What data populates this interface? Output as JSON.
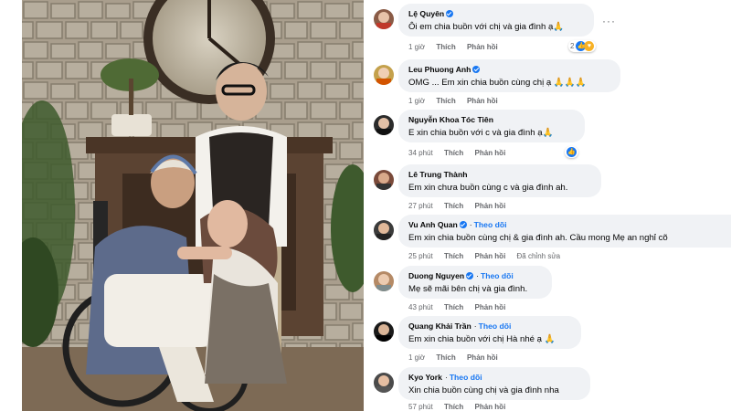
{
  "comments": [
    {
      "name": "Lệ Quyên",
      "verified": true,
      "follow": "",
      "text": "Ôi em chia buồn với chị và gia đình ạ🙏",
      "time": "1 giờ",
      "like": "Thích",
      "reply": "Phản hồi",
      "edited": "",
      "react_count": "2"
    },
    {
      "name": "Leu Phuong Anh",
      "verified": true,
      "follow": "",
      "text": "OMG ... Em xin chia buồn cùng chị ạ 🙏🙏🙏",
      "time": "1 giờ",
      "like": "Thích",
      "reply": "Phản hồi",
      "edited": "",
      "react_count": ""
    },
    {
      "name": "Nguyễn Khoa Tóc Tiên",
      "verified": false,
      "follow": "",
      "text": "E xin chia buồn với c và gia đình ạ🙏",
      "time": "34 phút",
      "like": "Thích",
      "reply": "Phản hồi",
      "edited": "",
      "react_count": ""
    },
    {
      "name": "Lê Trung Thành",
      "verified": false,
      "follow": "",
      "text": "Em xin chưa buồn cùng c và gia đình ah.",
      "time": "27 phút",
      "like": "Thích",
      "reply": "Phản hồi",
      "edited": "",
      "react_count": ""
    },
    {
      "name": "Vu Anh Quan",
      "verified": true,
      "follow": "Theo dõi",
      "text": "Em xin chia buồn cùng chị & gia đình ah. Cầu mong Mẹ an nghỉ cõ",
      "time": "25 phút",
      "like": "Thích",
      "reply": "Phản hồi",
      "edited": "Đã chỉnh sửa",
      "react_count": ""
    },
    {
      "name": "Duong Nguyen",
      "verified": true,
      "follow": "Theo dõi",
      "text": "Mẹ sẽ mãi bên chị và gia đình.",
      "time": "43 phút",
      "like": "Thích",
      "reply": "Phản hồi",
      "edited": "",
      "react_count": ""
    },
    {
      "name": "Quang Khải Trần",
      "verified": false,
      "follow": "Theo dõi",
      "text": "Em xin chia buồn với chị Hà nhé ạ 🙏",
      "time": "1 giờ",
      "like": "Thích",
      "reply": "Phản hồi",
      "edited": "",
      "react_count": ""
    },
    {
      "name": "Kyo York",
      "verified": false,
      "follow": "Theo dõi",
      "text": "Xin chia buồn cùng chị và gia đình nha",
      "time": "57 phút",
      "like": "Thích",
      "reply": "Phản hồi",
      "edited": "",
      "react_count": ""
    }
  ],
  "more_options": "···",
  "colors": {
    "bubble": "#f0f2f5",
    "link": "#1877f2",
    "meta": "#65676b",
    "text": "#050505"
  },
  "photo": {
    "description_icon": "photo-image"
  }
}
